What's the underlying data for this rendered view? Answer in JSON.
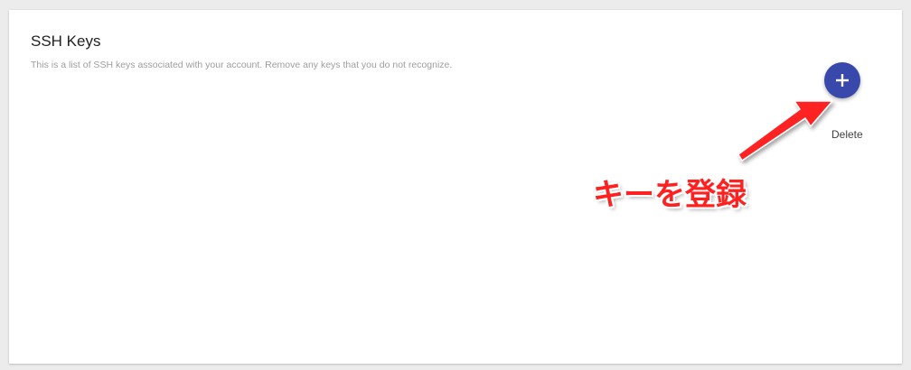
{
  "ssh_keys": {
    "title": "SSH Keys",
    "description": "This is a list of SSH keys associated with your account. Remove any keys that you do not recognize.",
    "add_button_icon": "plus-icon",
    "delete_label": "Delete"
  },
  "annotation": {
    "label": "キーを登録",
    "color": "#ff2020"
  },
  "colors": {
    "fab": "#3949ab",
    "background": "#ececec",
    "card": "#ffffff"
  }
}
